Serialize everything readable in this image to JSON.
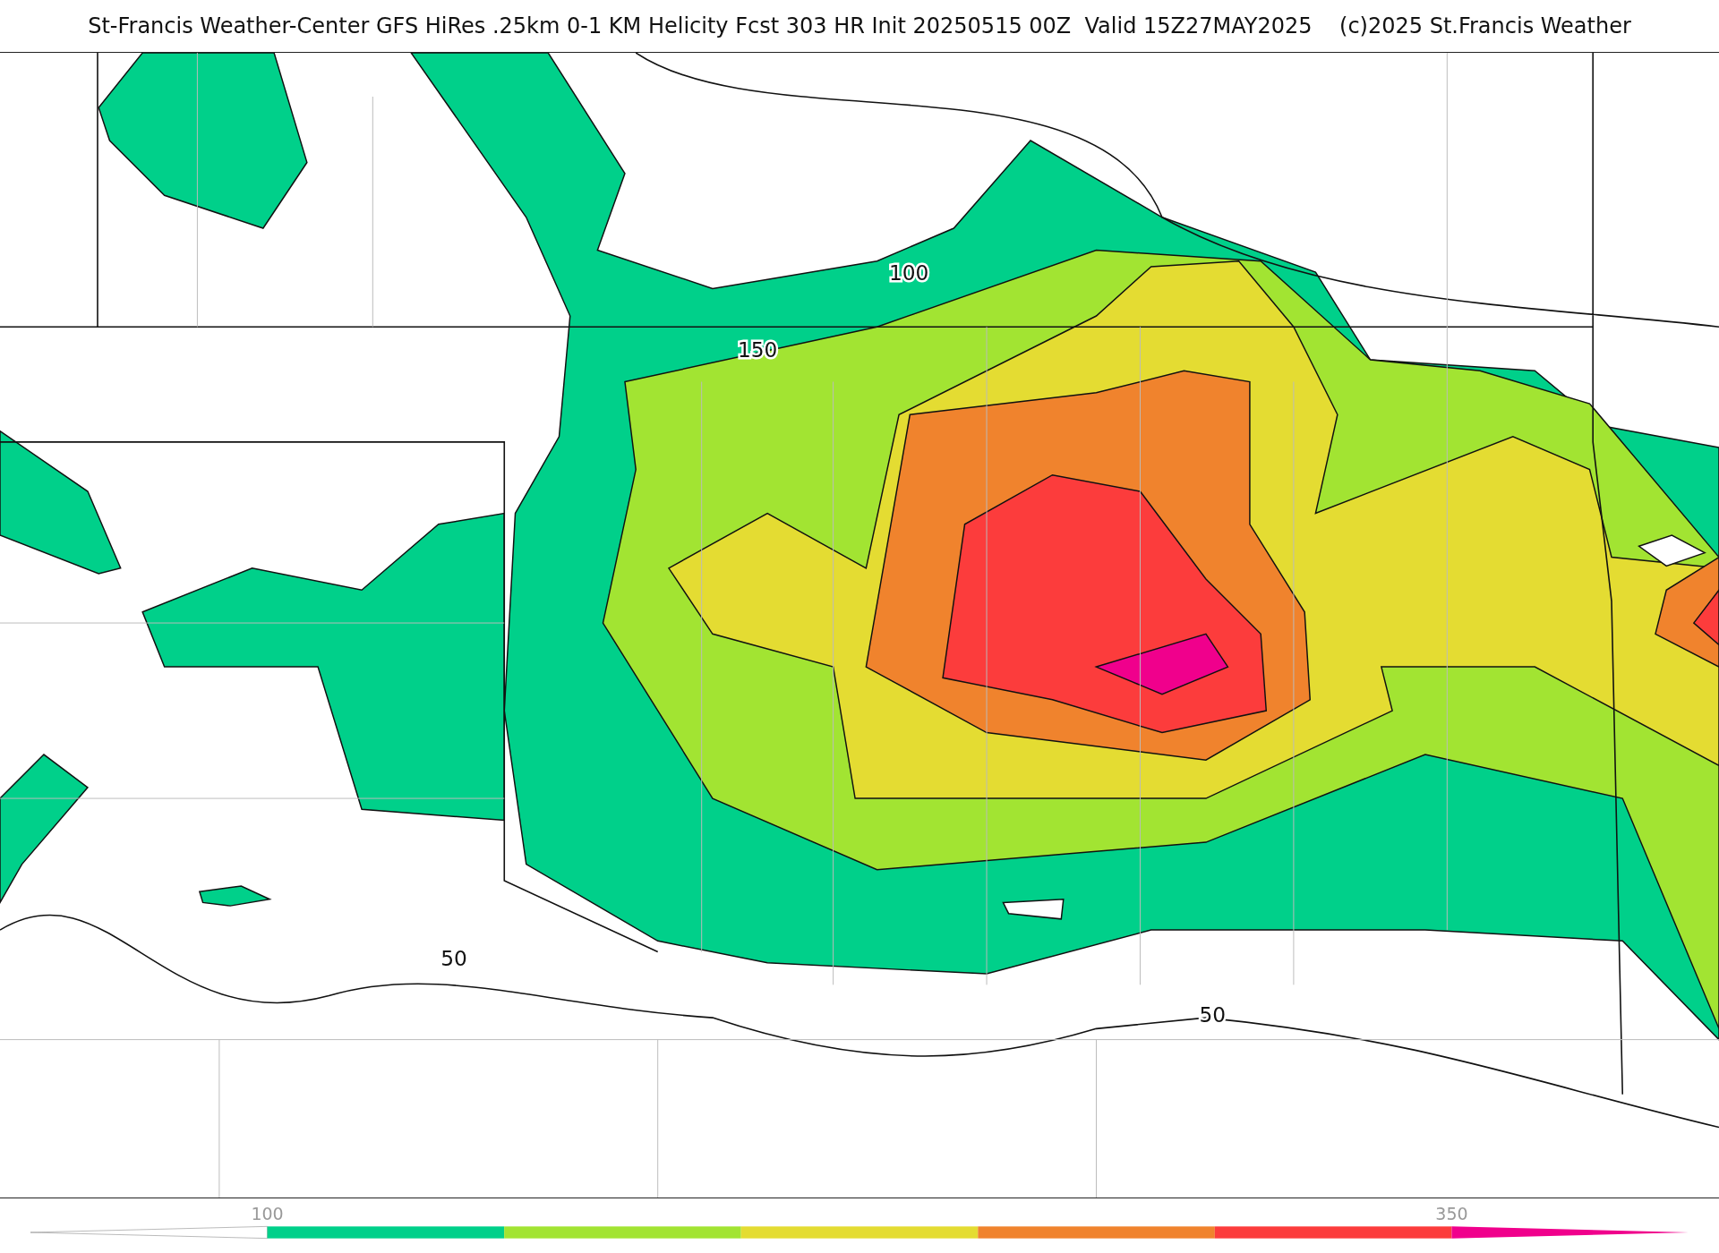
{
  "title": "St-Francis Weather-Center GFS HiRes .25km 0-1 KM Helicity Fcst 303 HR Init 20250515 00Z  Valid 15Z27MAY2025    (c)2025 St.Francis Weather",
  "map": {
    "contour_labels": [
      "100",
      "150",
      "50",
      "50"
    ]
  },
  "colorbar": {
    "bins": [
      {
        "color": "#00d08a",
        "label": "100"
      },
      {
        "color": "#a2e432"
      },
      {
        "color": "#e4dc32"
      },
      {
        "color": "#f0832d"
      },
      {
        "color": "#fc3c3c"
      },
      {
        "color": "#f0008c",
        "label": "350"
      }
    ]
  }
}
